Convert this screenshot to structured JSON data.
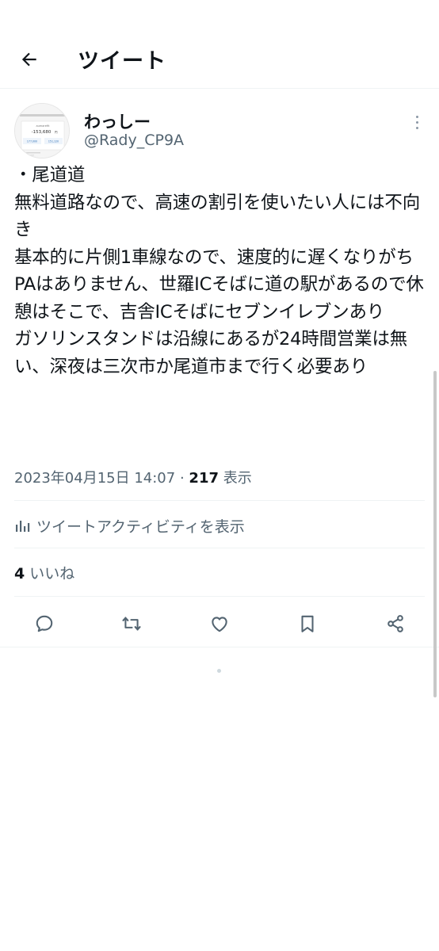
{
  "header": {
    "title": "ツイート",
    "back_icon": "arrow-left-icon"
  },
  "tweet": {
    "display_name": "わっしー",
    "handle": "@Rady_CP9A",
    "avatar_lettering": {
      "title": "aumarefit",
      "amount": "-153,680",
      "unit": "円",
      "stat_left": "177,000",
      "stat_right": "151,120"
    },
    "text": "・尾道道\n無料道路なので、高速の割引を使いたい人には不向き\n基本的に片側1車線なので、速度的に遅くなりがち\nPAはありません、世羅ICそばに道の駅があるので休憩はそこで、吉舎ICそばにセブンイレブンあり\nガソリンスタンドは沿線にあるが24時間営業は無い、深夜は三次市か尾道市まで行く必要あり",
    "timestamp": "2023年04月15日 14:07",
    "separator": "·",
    "views_count": "217",
    "views_label": "表示",
    "activity_label": "ツイートアクティビティを表示",
    "likes_count": "4",
    "likes_label": "いいね"
  },
  "actions": [
    "reply-icon",
    "retweet-icon",
    "like-icon",
    "bookmark-icon",
    "share-icon"
  ],
  "colors": {
    "text": "#0f1419",
    "secondary": "#536471",
    "divider": "#eff3f4",
    "background": "#ffffff"
  }
}
